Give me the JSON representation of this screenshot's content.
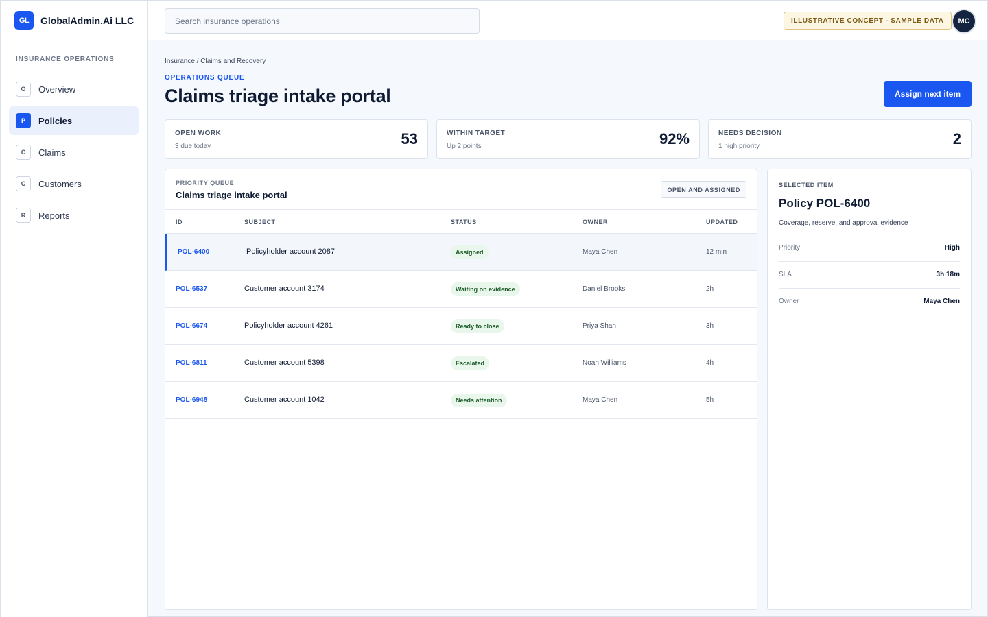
{
  "brand": {
    "logo_text": "GL",
    "name": "GlobalAdmin.Ai LLC"
  },
  "sidebar": {
    "section_title": "INSURANCE OPERATIONS",
    "items": [
      {
        "badge": "O",
        "label": "Overview",
        "active": false
      },
      {
        "badge": "P",
        "label": "Policies",
        "active": true
      },
      {
        "badge": "C",
        "label": "Claims",
        "active": false
      },
      {
        "badge": "C",
        "label": "Customers",
        "active": false
      },
      {
        "badge": "R",
        "label": "Reports",
        "active": false
      }
    ]
  },
  "topbar": {
    "search_placeholder": "Search insurance operations",
    "concept_badge": "ILLUSTRATIVE CONCEPT - SAMPLE DATA",
    "avatar_initials": "MC"
  },
  "header": {
    "breadcrumb": "Insurance / Claims and Recovery",
    "eyebrow": "OPERATIONS QUEUE",
    "title": "Claims triage intake portal",
    "primary_action": "Assign next item"
  },
  "stats": [
    {
      "label": "OPEN WORK",
      "sub": "3 due today",
      "value": "53"
    },
    {
      "label": "WITHIN TARGET",
      "sub": "Up 2 points",
      "value": "92%"
    },
    {
      "label": "NEEDS DECISION",
      "sub": "1 high priority",
      "value": "2"
    }
  ],
  "queue": {
    "eyebrow": "PRIORITY QUEUE",
    "title": "Claims triage intake portal",
    "filter": "OPEN AND ASSIGNED",
    "columns": {
      "id": "ID",
      "subject": "SUBJECT",
      "status": "STATUS",
      "owner": "OWNER",
      "updated": "UPDATED"
    },
    "rows": [
      {
        "id": "POL-6400",
        "subject": "Policyholder account 2087",
        "status": "Assigned",
        "owner": "Maya Chen",
        "updated": "12 min"
      },
      {
        "id": "POL-6537",
        "subject": "Customer account 3174",
        "status": "Waiting on evidence",
        "owner": "Daniel Brooks",
        "updated": "2h"
      },
      {
        "id": "POL-6674",
        "subject": "Policyholder account 4261",
        "status": "Ready to close",
        "owner": "Priya Shah",
        "updated": "3h"
      },
      {
        "id": "POL-6811",
        "subject": "Customer account 5398",
        "status": "Escalated",
        "owner": "Noah Williams",
        "updated": "4h"
      },
      {
        "id": "POL-6948",
        "subject": "Customer account 1042",
        "status": "Needs attention",
        "owner": "Maya Chen",
        "updated": "5h"
      }
    ]
  },
  "detail": {
    "eyebrow": "SELECTED ITEM",
    "title": "Policy POL-6400",
    "description": "Coverage, reserve, and approval evidence",
    "fields": [
      {
        "key": "Priority",
        "value": "High"
      },
      {
        "key": "SLA",
        "value": "3h 18m"
      },
      {
        "key": "Owner",
        "value": "Maya Chen"
      }
    ]
  },
  "colors": {
    "accent": "#1a56f0",
    "ink": "#0f1b33",
    "status_bg": "#e9f6ec",
    "status_text": "#1f5d2b",
    "concept_bg": "#fdf6e3"
  }
}
